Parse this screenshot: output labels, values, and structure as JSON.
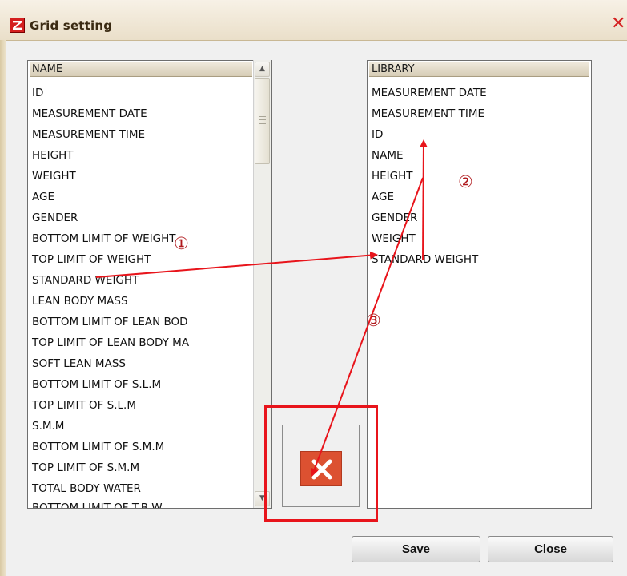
{
  "window": {
    "title": "Grid setting",
    "close_glyph": "✕"
  },
  "name_list": {
    "header": "NAME",
    "items": [
      "ID",
      "MEASUREMENT DATE",
      "MEASUREMENT TIME",
      "HEIGHT",
      "WEIGHT",
      "AGE",
      "GENDER",
      "BOTTOM LIMIT OF WEIGHT",
      "TOP LIMIT OF WEIGHT",
      "STANDARD WEIGHT",
      "LEAN BODY MASS",
      "BOTTOM LIMIT OF LEAN BOD",
      "TOP LIMIT OF LEAN BODY MA",
      "SOFT LEAN MASS",
      "BOTTOM LIMIT OF S.L.M",
      "TOP LIMIT OF S.L.M",
      "S.M.M",
      "BOTTOM LIMIT OF S.M.M",
      "TOP LIMIT OF S.M.M",
      "TOTAL BODY WATER",
      "BOTTOM LIMIT OF T.B.W"
    ]
  },
  "library_list": {
    "header": "LIBRARY",
    "items": [
      "MEASUREMENT DATE",
      "MEASUREMENT TIME",
      "ID",
      "NAME",
      "HEIGHT",
      "AGE",
      "GENDER",
      "WEIGHT",
      "STANDARD WEIGHT"
    ]
  },
  "buttons": {
    "save_label": "Save",
    "close_label": "Close"
  },
  "annotations": {
    "step1": "①",
    "step2": "②",
    "step3": "③",
    "arrow_color": "#e8141b"
  },
  "icons": {
    "app": "app-logo-icon",
    "remove": "remove-x-icon",
    "scroll_up": "scroll-up-arrow-icon",
    "scroll_down": "scroll-down-arrow-icon"
  }
}
